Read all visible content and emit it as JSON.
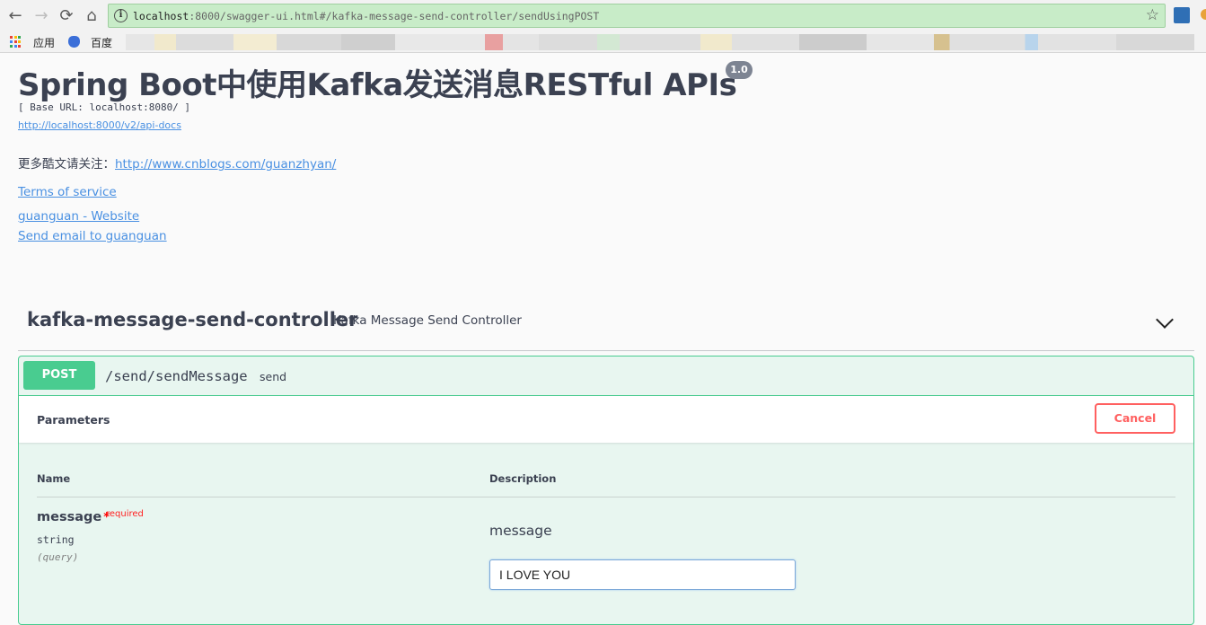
{
  "browser": {
    "url_host": "localhost",
    "url_rest": ":8000/swagger-ui.html#/kafka-message-send-controller/sendUsingPOST",
    "bookmarks": [
      "应用",
      "百度"
    ],
    "icons": [
      "back-arrow-icon",
      "forward-arrow-icon",
      "reload-icon",
      "home-icon",
      "info-icon",
      "star-icon",
      "apps-icon",
      "baidu-paw-icon"
    ]
  },
  "info": {
    "title": "Spring Boot中使用Kafka发送消息RESTful APIs",
    "version": "1.0",
    "base_url": "[ Base URL: localhost:8080/ ]",
    "api_docs_link": "http://localhost:8000/v2/api-docs",
    "follow_text": "更多酷文请关注：",
    "follow_link": "http://www.cnblogs.com/guanzhyan/",
    "terms": "Terms of service",
    "website": "guanguan - Website",
    "email": "Send email to guanguan"
  },
  "tag": {
    "name": "kafka-message-send-controller",
    "description": "Kafka Message Send Controller"
  },
  "operation": {
    "method": "POST",
    "path": "/send/sendMessage",
    "summary": "send",
    "parameters_title": "Parameters",
    "cancel_label": "Cancel",
    "col_name": "Name",
    "col_description": "Description",
    "param": {
      "name": "message",
      "required_mark": "*",
      "required_label": "required",
      "type": "string",
      "in": "(query)",
      "description": "message",
      "value": "I LOVE YOU"
    }
  },
  "colors": {
    "post_green": "#49cc90",
    "cancel_red": "#ff6060",
    "link_blue": "#4990e2",
    "text_dark": "#3b4151"
  }
}
